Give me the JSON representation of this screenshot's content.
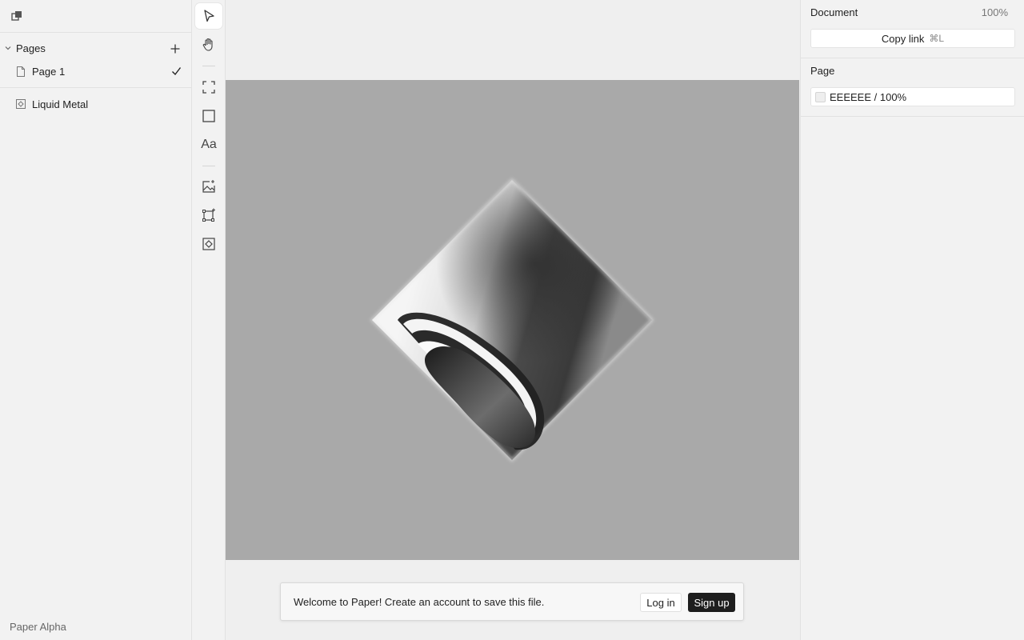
{
  "left_panel": {
    "pages_label": "Pages",
    "pages": [
      {
        "label": "Page 1",
        "selected": true
      }
    ],
    "layers": [
      {
        "label": "Liquid Metal"
      }
    ],
    "footer_label": "Paper Alpha"
  },
  "toolbar": {
    "tools": [
      "select-tool",
      "hand-tool",
      "frame-tool",
      "rectangle-tool",
      "text-tool",
      "image-tool",
      "ai-frame-tool",
      "shader-tool"
    ],
    "active_tool": "select-tool",
    "text_tool_glyph": "Aa"
  },
  "canvas": {
    "artboard_color": "#A9A9A9",
    "toast": {
      "message": "Welcome to Paper! Create an account to save this file.",
      "login_label": "Log in",
      "signup_label": "Sign up"
    }
  },
  "right_panel": {
    "document_label": "Document",
    "zoom": "100%",
    "copy_link_label": "Copy link",
    "copy_link_shortcut": "⌘L",
    "page_label": "Page",
    "page_fill": "EEEEEE / 100%",
    "page_fill_color": "#EEEEEE"
  }
}
